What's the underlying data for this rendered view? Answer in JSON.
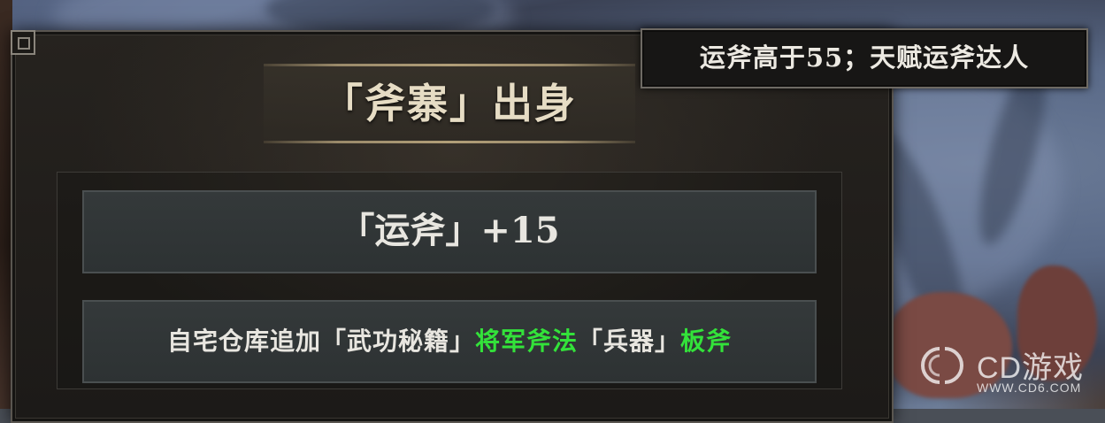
{
  "tooltip": {
    "text": "运斧高于55；天赋运斧达人"
  },
  "panel": {
    "title": "「斧寨」出身",
    "effects": {
      "line1": "「运斧」+15",
      "line2": {
        "prefix": "自宅仓库追加「武功秘籍」",
        "item1": "将军斧法",
        "middle": "「兵器」",
        "item2": "板斧"
      }
    }
  },
  "watermark": {
    "name": "CD游戏",
    "url": "WWW.CD6.COM",
    "logo_icon": "cd-logo-icon"
  },
  "colors": {
    "highlight_green": "#33e23a",
    "title_gold": "#e6dcc4"
  }
}
